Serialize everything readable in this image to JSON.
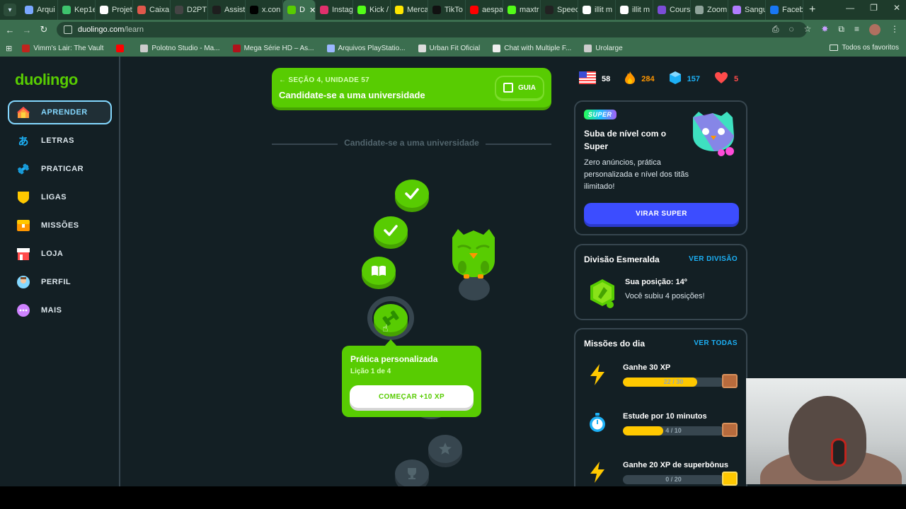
{
  "browser": {
    "tabs": [
      {
        "label": "Arqui",
        "color": "#7aa7ff"
      },
      {
        "label": "Kep1e",
        "color": "#3ec46d"
      },
      {
        "label": "Projet",
        "color": "#ffffff"
      },
      {
        "label": "Caixa",
        "color": "#e0584b"
      },
      {
        "label": "D2PT",
        "color": "#444444"
      },
      {
        "label": "Assist",
        "color": "#1e1e1e"
      },
      {
        "label": "x.con",
        "color": "#000000"
      },
      {
        "label": "D",
        "color": "#58cc02",
        "active": true
      },
      {
        "label": "Instag",
        "color": "#e1306c"
      },
      {
        "label": "Kick /",
        "color": "#53fc18"
      },
      {
        "label": "Merca",
        "color": "#ffe600"
      },
      {
        "label": "TikTo",
        "color": "#111111"
      },
      {
        "label": "aespa",
        "color": "#ff0000"
      },
      {
        "label": "maxtr",
        "color": "#53fc18"
      },
      {
        "label": "Speec",
        "color": "#222222"
      },
      {
        "label": "illit m",
        "color": "#ffffff"
      },
      {
        "label": "illit m",
        "color": "#ffffff"
      },
      {
        "label": "Cours",
        "color": "#7b4dd6"
      },
      {
        "label": "Zoom",
        "color": "#8fa39a"
      },
      {
        "label": "Sangu",
        "color": "#b07cff"
      },
      {
        "label": "Faceb",
        "color": "#1877f2"
      }
    ],
    "new_tab": "+",
    "url_host": "duolingo.com",
    "url_path": "/learn",
    "bookmarks": [
      {
        "label": "Vimm's Lair: The Vault",
        "color": "#c0241d"
      },
      {
        "label": "",
        "color": "#ff0000"
      },
      {
        "label": "Polotno Studio - Ma...",
        "color": "#cccccc"
      },
      {
        "label": "Mega Série HD – As...",
        "color": "#b0121b"
      },
      {
        "label": "Arquivos PlayStatio...",
        "color": "#9bb7ff"
      },
      {
        "label": "Urban Fit Oficial",
        "color": "#dddddd"
      },
      {
        "label": "Chat with Multiple F...",
        "color": "#eeeeee"
      },
      {
        "label": "Urolarge",
        "color": "#cccccc"
      }
    ],
    "all_bookmarks": "Todos os favoritos"
  },
  "sidebar": {
    "logo": "duolingo",
    "items": [
      {
        "label": "APRENDER",
        "icon": "home-icon",
        "active": true
      },
      {
        "label": "LETRAS",
        "icon": "letters-icon"
      },
      {
        "label": "PRATICAR",
        "icon": "dumbbell-icon"
      },
      {
        "label": "LIGAS",
        "icon": "shield-icon"
      },
      {
        "label": "MISSÕES",
        "icon": "chest-icon"
      },
      {
        "label": "LOJA",
        "icon": "shop-icon"
      },
      {
        "label": "PERFIL",
        "icon": "avatar-icon"
      },
      {
        "label": "MAIS",
        "icon": "more-icon"
      }
    ]
  },
  "unit": {
    "section": "SEÇÃO 4, UNIDADE 57",
    "title": "Candidate-se a uma universidade",
    "guide_label": "GUIA",
    "divider_title": "Candidate-se a uma universidade"
  },
  "popup": {
    "title": "Prática personalizada",
    "subtitle": "Lição 1 de 4",
    "button": "COMEÇAR +10 XP"
  },
  "stats": {
    "language_count": "58",
    "streak": "284",
    "gems": "157",
    "hearts": "5",
    "streak_color": "#ff9600",
    "gems_color": "#1cb0f6",
    "hearts_color": "#ff4b4b"
  },
  "super": {
    "badge": "SUPER",
    "title": "Suba de nível com o Super",
    "description": "Zero anúncios, prática personalizada e nível dos titãs ilimitado!",
    "button": "VIRAR SUPER"
  },
  "league": {
    "title": "Divisão Esmeralda",
    "link": "VER DIVISÃO",
    "position": "Sua posição: 14º",
    "movement": "Você subiu 4 posições!"
  },
  "quests": {
    "title": "Missões do dia",
    "link": "VER TODAS",
    "items": [
      {
        "title": "Ganhe 30 XP",
        "progress_text": "22 / 30",
        "progress": 0.7333,
        "icon": "lightning-icon"
      },
      {
        "title": "Estude por 10 minutos",
        "progress_text": "4 / 10",
        "progress": 0.4,
        "icon": "timer-icon"
      },
      {
        "title": "Ganhe 20 XP de superbônus",
        "progress_text": "0 / 20",
        "progress": 0,
        "icon": "lightning-icon"
      }
    ]
  },
  "colors": {
    "brand_green": "#58cc02",
    "background": "#131f24",
    "active_blue": "#84d8ff",
    "super_blue": "#3c4dff"
  }
}
